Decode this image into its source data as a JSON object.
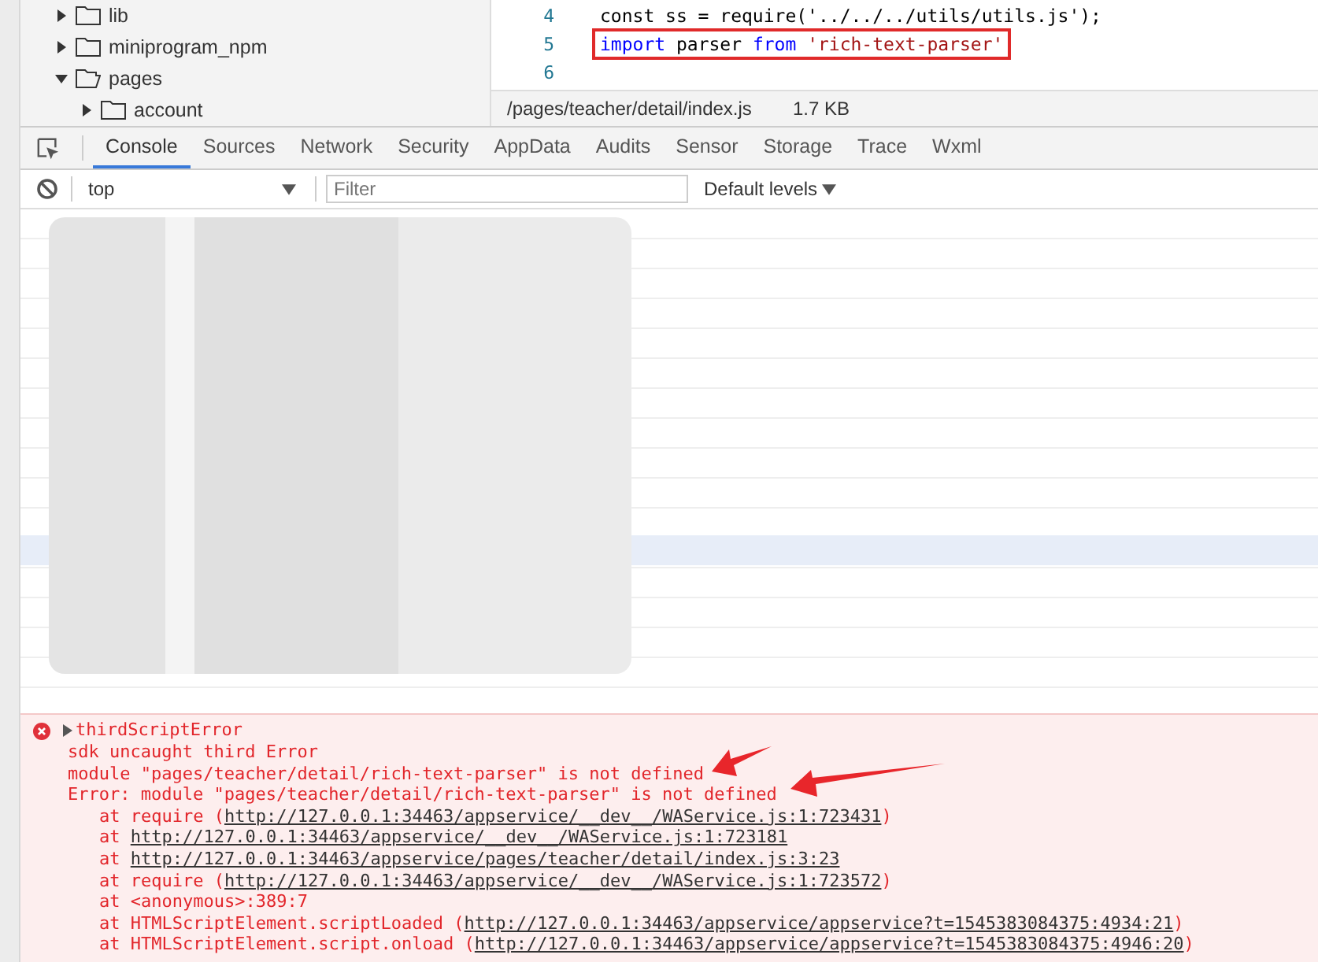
{
  "file_tree": [
    {
      "label": "lib",
      "expanded": false
    },
    {
      "label": "miniprogram_npm",
      "expanded": false
    },
    {
      "label": "pages",
      "expanded": true,
      "children": [
        {
          "label": "account",
          "expanded": false
        }
      ]
    }
  ],
  "editor": {
    "lines": [
      {
        "number": "4",
        "highlighted": false,
        "tokens": [
          {
            "kind": "plain",
            "text": "const ss = require('../../../utils/utils.js');"
          }
        ]
      },
      {
        "number": "5",
        "highlighted": true,
        "tokens": [
          {
            "kind": "keyword",
            "text": "import"
          },
          {
            "kind": "plain",
            "text": " parser "
          },
          {
            "kind": "keyword",
            "text": "from"
          },
          {
            "kind": "string",
            "text": " 'rich-text-parser'"
          }
        ]
      },
      {
        "number": "6"
      }
    ],
    "status": {
      "path": "/pages/teacher/detail/index.js",
      "size": "1.7 KB"
    }
  },
  "devtools": {
    "tabs": [
      {
        "label": "Console",
        "selected": true
      },
      {
        "label": "Sources",
        "selected": false
      },
      {
        "label": "Network",
        "selected": false
      },
      {
        "label": "Security",
        "selected": false
      },
      {
        "label": "AppData",
        "selected": false
      },
      {
        "label": "Audits",
        "selected": false
      },
      {
        "label": "Sensor",
        "selected": false
      },
      {
        "label": "Storage",
        "selected": false
      },
      {
        "label": "Trace",
        "selected": false
      },
      {
        "label": "Wxml",
        "selected": false
      }
    ],
    "context_select": "top",
    "filter": {
      "placeholder": "Filter"
    },
    "levels": "Default levels"
  },
  "error": {
    "title": "thirdScriptError",
    "messages": [
      "sdk uncaught third Error",
      "module \"pages/teacher/detail/rich-text-parser\" is not defined",
      "Error: module \"pages/teacher/detail/rich-text-parser\" is not defined"
    ],
    "stack": [
      {
        "prefix": "at require (",
        "link": "http://127.0.0.1:34463/appservice/__dev__/WAService.js:1:723431",
        "suffix": ")"
      },
      {
        "prefix": "at ",
        "link": "http://127.0.0.1:34463/appservice/__dev__/WAService.js:1:723181"
      },
      {
        "prefix": "at ",
        "link": "http://127.0.0.1:34463/appservice/pages/teacher/detail/index.js:3:23"
      },
      {
        "prefix": "at require (",
        "link": "http://127.0.0.1:34463/appservice/__dev__/WAService.js:1:723572",
        "suffix": ")"
      },
      {
        "prefix": "at <anonymous>:389:7"
      },
      {
        "prefix": "at HTMLScriptElement.scriptLoaded (",
        "link": "http://127.0.0.1:34463/appservice/appservice?t=1545383084375:4934:21",
        "suffix": ")"
      },
      {
        "prefix": "at HTMLScriptElement.script.onload (",
        "link": "http://127.0.0.1:34463/appservice/appservice?t=1545383084375:4946:20",
        "suffix": ")"
      }
    ]
  }
}
